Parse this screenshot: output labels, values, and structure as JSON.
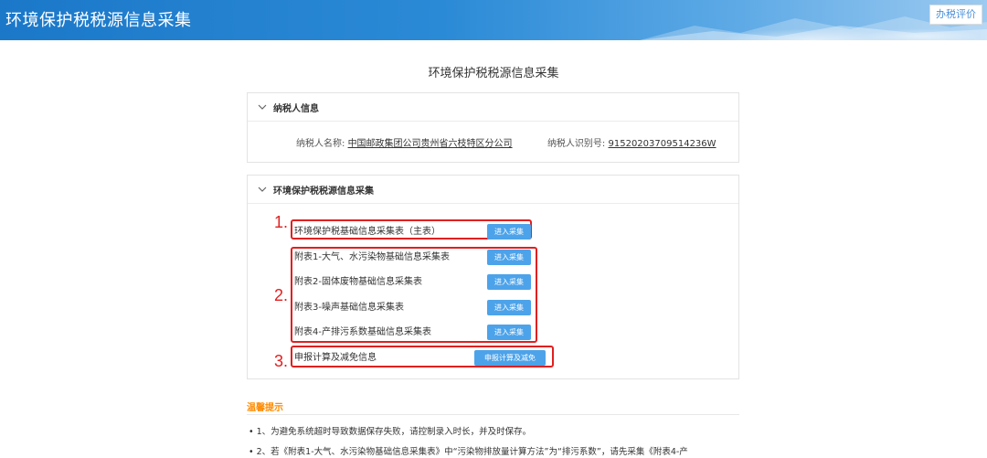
{
  "header": {
    "title": "环境保护税税源信息采集",
    "rate_button": "办税评价"
  },
  "page": {
    "title": "环境保护税税源信息采集"
  },
  "taxpayer": {
    "section_title": "纳税人信息",
    "name_label": "纳税人名称:",
    "name_value": "中国邮政集团公司贵州省六枝特区分公司",
    "id_label": "纳税人识别号:",
    "id_value": "91520203709514236W"
  },
  "collection": {
    "section_title": "环境保护税税源信息采集",
    "annotations": [
      "1.",
      "2.",
      "3."
    ],
    "items": [
      {
        "label": "环境保护税基础信息采集表（主表）",
        "button": "进入采集"
      },
      {
        "label": "附表1-大气、水污染物基础信息采集表",
        "button": "进入采集"
      },
      {
        "label": "附表2-固体废物基础信息采集表",
        "button": "进入采集"
      },
      {
        "label": "附表3-噪声基础信息采集表",
        "button": "进入采集"
      },
      {
        "label": "附表4-产排污系数基础信息采集表",
        "button": "进入采集"
      },
      {
        "label": "申报计算及减免信息",
        "button": "申报计算及减免"
      }
    ]
  },
  "tips": {
    "title": "温馨提示",
    "items": [
      "• 1、为避免系统超时导致数据保存失败，请控制录入时长，并及时保存。",
      "• 2、若《附表1-大气、水污染物基础信息采集表》中“污染物排放量计算方法”为“排污系数”，请先采集《附表4-产"
    ]
  },
  "colors": {
    "banner": "#2b8ad6",
    "accent_button": "#4da3ea",
    "annotation_red": "#e02020",
    "tips_orange": "#ff8a00"
  }
}
